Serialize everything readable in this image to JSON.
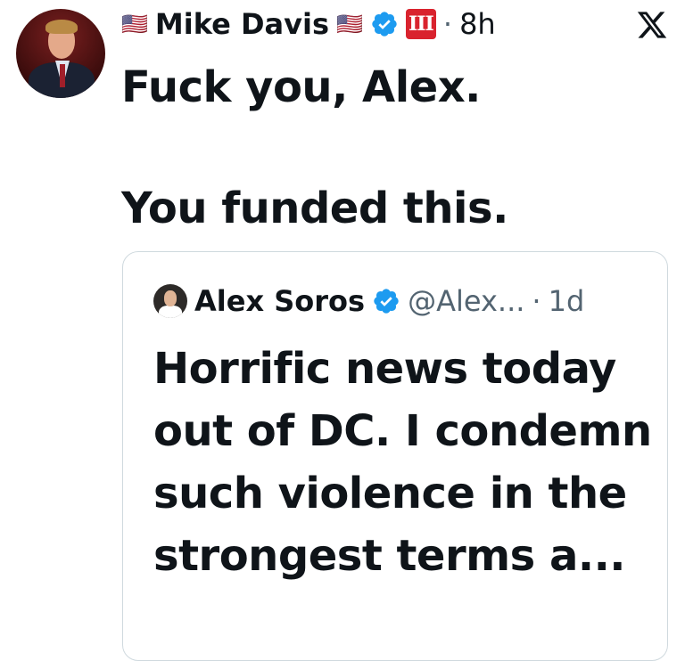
{
  "post": {
    "author_name": "Mike Davis",
    "flag_left": "🇺🇸",
    "flag_right": "🇺🇸",
    "sigil": "III",
    "dot": "·",
    "time": "8h",
    "text_line_1": "Fuck you, Alex.",
    "text_line_2": "You funded this."
  },
  "quote": {
    "author_name": "Alex Soros",
    "handle": "@Alex...",
    "dot": "·",
    "time": "1d",
    "text": "Horrific news today out of DC. I condemn such violence in the strongest terms a..."
  },
  "colors": {
    "verified": "#1d9bf0",
    "sigil_bg": "#d9232e",
    "border": "#cfd9de",
    "secondary_text": "#536471"
  },
  "icons": [
    "verified-badge-icon",
    "x-logo-icon",
    "flag-icon"
  ]
}
